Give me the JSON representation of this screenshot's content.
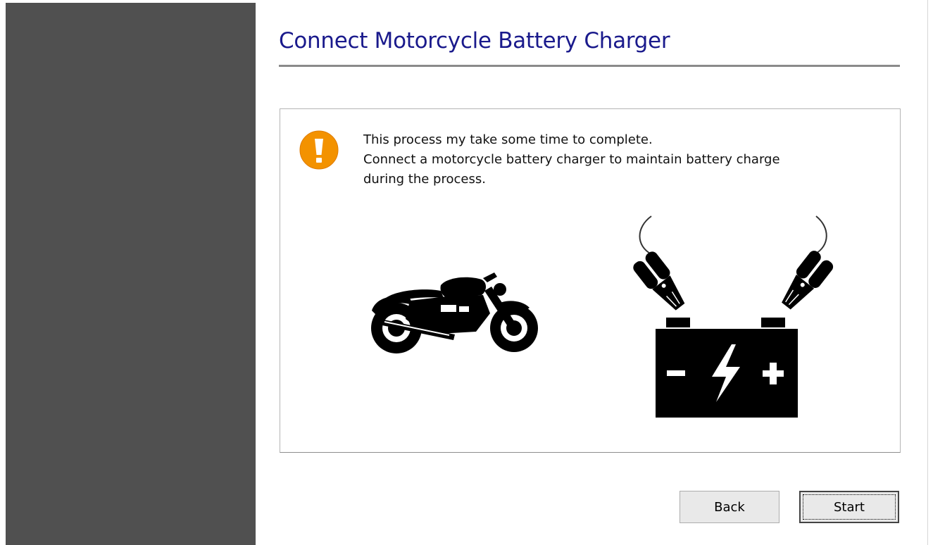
{
  "page": {
    "title": "Connect Motorcycle Battery Charger"
  },
  "notice": {
    "icon": "warning-exclamation-icon",
    "icon_color": "#f39200",
    "lines": [
      "This process my take some time to complete.",
      "Connect a motorcycle battery charger to maintain battery charge",
      "during the process."
    ]
  },
  "illustrations": {
    "motorcycle": "motorcycle-icon",
    "battery": "car-battery-with-clamps-icon"
  },
  "buttons": {
    "back_label": "Back",
    "start_label": "Start"
  },
  "colors": {
    "sidebar": "#505050",
    "title": "#1a1a8c"
  }
}
